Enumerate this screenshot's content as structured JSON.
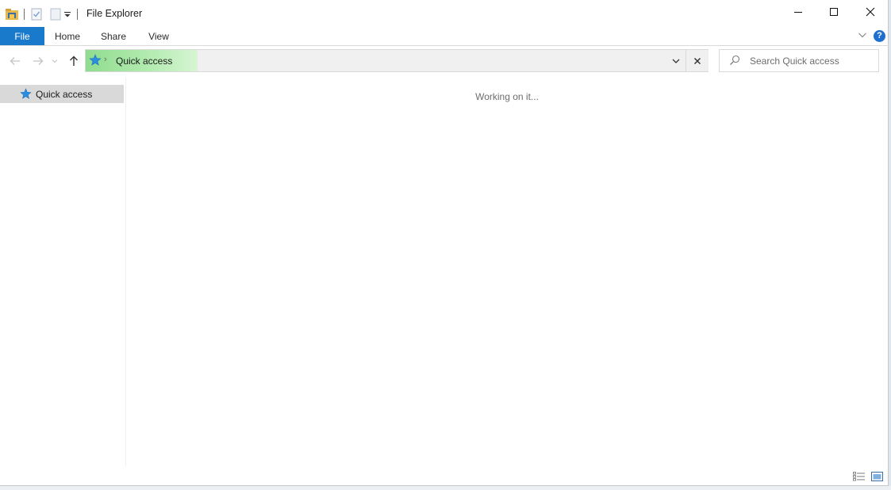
{
  "window": {
    "title": "File Explorer"
  },
  "icons": {
    "app": "file-explorer-folder-icon",
    "properties": "properties-checkbox-icon",
    "new_folder": "new-folder-icon",
    "customize": "customize-toolbar-arrow-icon",
    "minimize": "minimize-icon",
    "maximize": "maximize-icon",
    "close": "close-icon",
    "back": "back-arrow-icon",
    "forward": "forward-arrow-icon",
    "recent": "recent-locations-chevron-icon",
    "up": "up-arrow-icon",
    "quick_access": "blue-star-pin-icon",
    "search": "magnifier-icon",
    "help": "help-icon"
  },
  "ribbon": {
    "tabs": [
      {
        "label": "File"
      },
      {
        "label": "Home"
      },
      {
        "label": "Share"
      },
      {
        "label": "View"
      }
    ],
    "help_glyph": "?"
  },
  "address": {
    "crumb": "Quick access",
    "chevron": "›"
  },
  "search": {
    "placeholder": "Search Quick access"
  },
  "nav_pane": {
    "items": [
      {
        "label": "Quick access"
      }
    ]
  },
  "content": {
    "status": "Working on it..."
  },
  "colors": {
    "file_tab": "#1979ca",
    "address_highlight": "#8fdc8f",
    "selected_nav": "#d9d9d9",
    "help": "#1f6fd1"
  }
}
